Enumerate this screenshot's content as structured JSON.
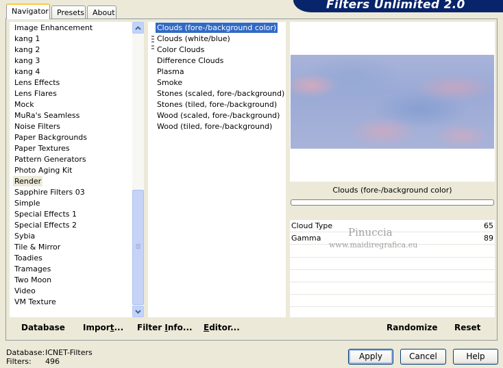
{
  "banner": {
    "title": "Filters Unlimited 2.0"
  },
  "tabs": [
    {
      "label": "Navigator",
      "active": true
    },
    {
      "label": "Presets",
      "active": false
    },
    {
      "label": "About",
      "active": false
    }
  ],
  "categories": [
    "Image Enhancement",
    "kang 1",
    "kang 2",
    "kang 3",
    "kang 4",
    "Lens Effects",
    "Lens Flares",
    "Mock",
    "MuRa's Seamless",
    "Noise Filters",
    "Paper Backgrounds",
    "Paper Textures",
    "Pattern Generators",
    "Photo Aging Kit",
    "Render",
    "Sapphire Filters 03",
    "Simple",
    "Special Effects 1",
    "Special Effects 2",
    "Sybia",
    "Tile & Mirror",
    "Toadies",
    "Tramages",
    "Two Moon",
    "Video",
    "VM Texture"
  ],
  "selected_category": "Render",
  "filters": [
    "Clouds (fore-/background color)",
    "Clouds (white/blue)",
    "Color Clouds",
    "Difference Clouds",
    "Plasma",
    "Smoke",
    "Stones (scaled, fore-/background)",
    "Stones (tiled, fore-/background)",
    "Wood (scaled, fore-/background)",
    "Wood (tiled, fore-/background)"
  ],
  "selected_filter": "Clouds (fore-/background color)",
  "preview": {
    "filter_name": "Clouds (fore-/background color)",
    "params": [
      {
        "label": "Cloud Type",
        "value": "65"
      },
      {
        "label": "Gamma",
        "value": "89"
      }
    ]
  },
  "watermark": {
    "line1": "Pinuccia",
    "line2": "www.maidiregrafica.eu"
  },
  "panel_buttons": {
    "database": "Database",
    "import": "Import...",
    "filter_info": "Filter Info...",
    "editor": "Editor...",
    "randomize": "Randomize",
    "reset": "Reset"
  },
  "status": {
    "database_label": "Database:",
    "database_value": "ICNET-Filters",
    "filters_label": "Filters:",
    "filters_value": "496"
  },
  "dialog_buttons": {
    "apply": "Apply",
    "cancel": "Cancel",
    "help": "Help"
  },
  "colors": {
    "banner_bg": "#08246b",
    "selection": "#316ac5",
    "window_bg": "#ece9d8"
  }
}
